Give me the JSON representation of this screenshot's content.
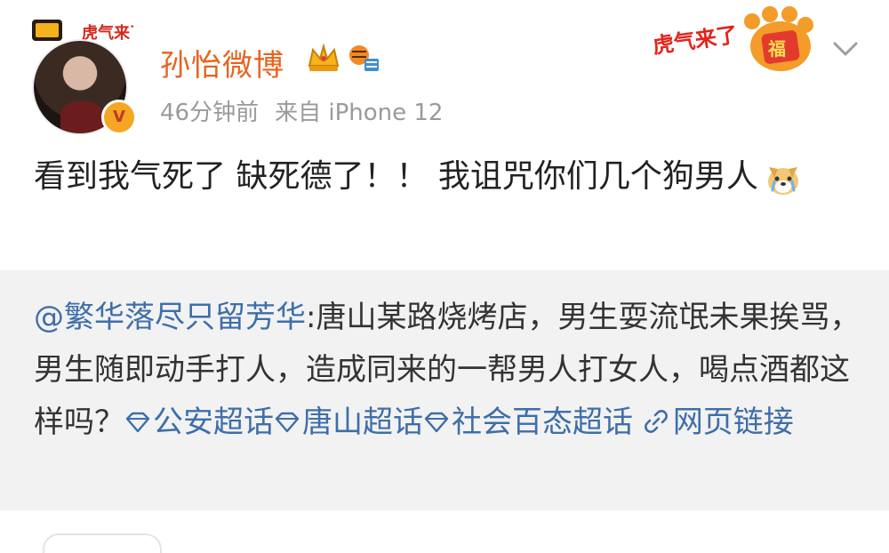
{
  "post": {
    "username": "孙怡微博",
    "time_ago": "46分钟前",
    "source": "来自 iPhone 12",
    "verified_badge": "V",
    "deco_label": "虎气来了",
    "text": "看到我气死了 缺死德了！！ 我诅咒你们几个狗男人"
  },
  "banner": {
    "label": "虎气来了",
    "fu": "福"
  },
  "repost": {
    "author": "@繁华落尽只留芳华",
    "body": ":唐山某路烧烤店，男生耍流氓未果挨骂，男生随即动手打人，造成同来的一帮男人打女人，喝点酒都这样吗？",
    "topics": [
      "公安超话",
      "唐山超话",
      "社会百态超话"
    ],
    "link_label": "网页链接"
  },
  "colors": {
    "username": "#e8631e",
    "meta": "#9a9a9a",
    "link": "#3e6ea9",
    "repost_bg": "#f2f2f2"
  },
  "icons": {
    "crown": "crown-icon",
    "tiger": "tiger-icon",
    "chevron": "chevron-down-icon",
    "topic": "diamond-topic-icon",
    "link": "link-icon",
    "emoji": "dog-crying-emoji"
  }
}
